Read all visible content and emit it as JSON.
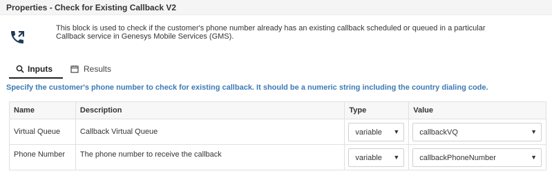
{
  "header": {
    "title": "Properties - Check for Existing Callback V2"
  },
  "block": {
    "icon": "phone-callback-icon",
    "description": "This block is used to check if the customer's phone number already has an existing callback scheduled or queued in a particular Callback service in Genesys Mobile Services (GMS)."
  },
  "tabs": [
    {
      "label": "Inputs",
      "icon": "search-icon",
      "active": true
    },
    {
      "label": "Results",
      "icon": "calendar-icon",
      "active": false
    }
  ],
  "instruction": "Specify the customer's phone number to check for existing callback. It should be a numeric string including the country dialing code.",
  "table": {
    "columns": [
      "Name",
      "Description",
      "Type",
      "Value"
    ],
    "rows": [
      {
        "name": "Virtual Queue",
        "description": "Callback Virtual Queue",
        "type": "variable",
        "value": "callbackVQ"
      },
      {
        "name": "Phone Number",
        "description": "The phone number to receive the callback",
        "type": "variable",
        "value": "callbackPhoneNumber"
      }
    ]
  },
  "colors": {
    "accent_text": "#3d7ab5",
    "header_bg": "#f5f5f5",
    "border": "#e0e0e0"
  }
}
